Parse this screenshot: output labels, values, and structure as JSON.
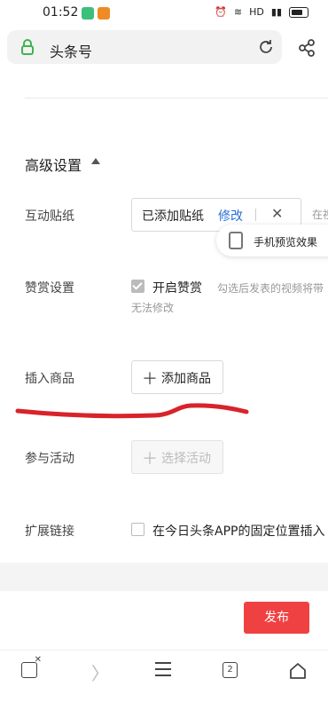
{
  "status_bar": {
    "time": "01:52",
    "network_label": "HD"
  },
  "url_bar": {
    "title": "头条号"
  },
  "section": {
    "title": "高级设置"
  },
  "rows": {
    "sticker": {
      "label": "互动贴纸",
      "added": "已添加贴纸",
      "edit": "修改",
      "close": "✕",
      "clipped_right": "在视",
      "preview": "手机预览效果"
    },
    "reward": {
      "label": "赞赏设置",
      "checkbox_label": "开启赞赏",
      "hint": "勾选后发表的视频将带",
      "hint2": "无法修改"
    },
    "product": {
      "label": "插入商品",
      "plus": "＋",
      "button": "添加商品"
    },
    "activity": {
      "label": "参与活动",
      "plus": "＋",
      "button": "选择活动"
    },
    "link": {
      "label": "扩展链接",
      "checkbox_label": "在今日头条APP的固定位置插入"
    }
  },
  "publish_button": "发布",
  "bottom_nav": {
    "tabs_count": "2",
    "forward": "〉"
  },
  "colors": {
    "accent_red": "#f04142",
    "link_blue": "#2a6fd6",
    "annotation_red": "#d8232a"
  }
}
